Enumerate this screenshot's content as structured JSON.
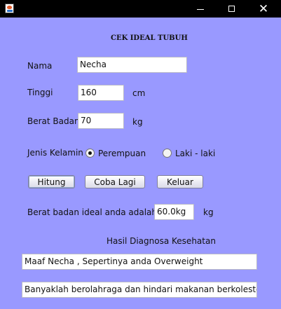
{
  "window": {
    "title_bar": {
      "minimize": "—",
      "maximize": "☐",
      "close": "✕"
    }
  },
  "form": {
    "title": "CEK IDEAL TUBUH",
    "nama_label": "Nama",
    "nama_value": "Necha",
    "tinggi_label": "Tinggi",
    "tinggi_value": "160",
    "tinggi_unit": "cm",
    "berat_label": "Berat Badan",
    "berat_value": "70",
    "berat_unit": "kg",
    "gender_label": "Jenis Kelamin",
    "gender_options": [
      {
        "label": "Perempuan",
        "selected": true
      },
      {
        "label": "Laki - laki",
        "selected": false
      }
    ],
    "buttons": {
      "hitung": "Hitung",
      "coba_lagi": "Coba Lagi",
      "keluar": "Keluar"
    },
    "ideal_label": "Berat badan ideal anda adalah",
    "ideal_value": "60.0kg",
    "ideal_unit": "kg",
    "diagnosis_heading": "Hasil Diagnosa Kesehatan",
    "diagnosis_result": "Maaf Necha , Sepertinya anda Overweight",
    "advice": "Banyaklah berolahraga dan hindari makanan berkolesterol"
  },
  "colors": {
    "background": "#9999ff",
    "titlebar": "#000000"
  }
}
